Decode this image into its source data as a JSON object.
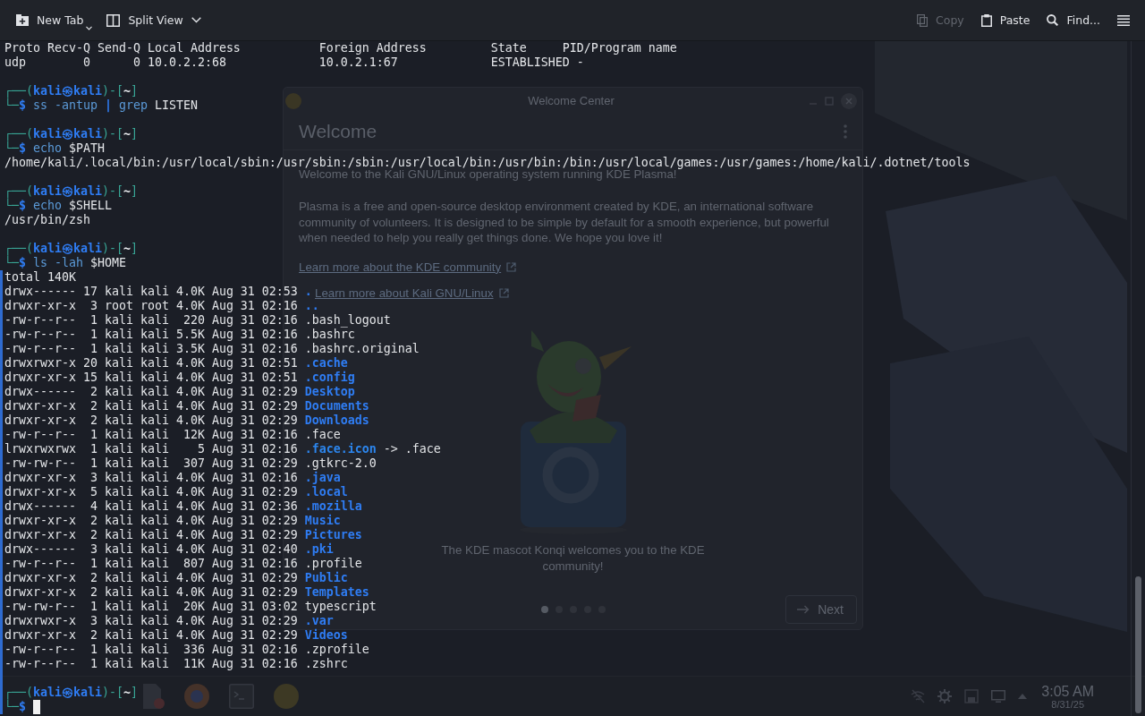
{
  "toolbar": {
    "buttons_left": [
      {
        "kind": "new-tab",
        "label": "New Tab",
        "disabled": false
      },
      {
        "kind": "split-view",
        "label": "Split View",
        "disabled": false
      }
    ],
    "buttons_right": [
      {
        "kind": "copy",
        "label": "Copy",
        "disabled": true
      },
      {
        "kind": "paste",
        "label": "Paste",
        "disabled": false
      },
      {
        "kind": "find",
        "label": "Find...",
        "disabled": false
      }
    ]
  },
  "terminal": {
    "lines": [
      {
        "kind": "output",
        "segments": [
          {
            "text": "Proto Recv-Q Send-Q Local Address           Foreign Address         State     PID/Program name",
            "kind": "text"
          }
        ]
      },
      {
        "kind": "output",
        "segments": [
          {
            "text": "udp        0      0 10.0.2.2:68             10.0.2.1:67             ESTABLISHED -",
            "kind": "text"
          }
        ]
      },
      {
        "kind": "blank"
      },
      {
        "kind": "prompt",
        "segments": [
          {
            "text": "┌──(",
            "kind": "frame"
          },
          {
            "text": "kali㉿kali",
            "kind": "user"
          },
          {
            "text": ")-[",
            "kind": "frame"
          },
          {
            "text": "~",
            "kind": "path"
          },
          {
            "text": "]",
            "kind": "frame"
          }
        ]
      },
      {
        "kind": "command",
        "segments": [
          {
            "text": "└─",
            "kind": "frame"
          },
          {
            "text": "$",
            "kind": "sigil"
          },
          {
            "text": " ss -antup ",
            "kind": "command"
          },
          {
            "text": "|",
            "kind": "pipe"
          },
          {
            "text": " grep",
            "kind": "command"
          },
          {
            "text": " LISTEN",
            "kind": "text"
          }
        ]
      },
      {
        "kind": "blank"
      },
      {
        "kind": "prompt",
        "segments": [
          {
            "text": "┌──(",
            "kind": "frame"
          },
          {
            "text": "kali㉿kali",
            "kind": "user"
          },
          {
            "text": ")-[",
            "kind": "frame"
          },
          {
            "text": "~",
            "kind": "path"
          },
          {
            "text": "]",
            "kind": "frame"
          }
        ]
      },
      {
        "kind": "command",
        "segments": [
          {
            "text": "└─",
            "kind": "frame"
          },
          {
            "text": "$",
            "kind": "sigil"
          },
          {
            "text": " echo",
            "kind": "command"
          },
          {
            "text": " $PATH",
            "kind": "text"
          }
        ]
      },
      {
        "kind": "output",
        "segments": [
          {
            "text": "/home/kali/.local/bin:/usr/local/sbin:/usr/sbin:/sbin:/usr/local/bin:/usr/bin:/bin:/usr/local/games:/usr/games:/home/kali/.dotnet/tools",
            "kind": "text"
          }
        ]
      },
      {
        "kind": "blank"
      },
      {
        "kind": "prompt",
        "segments": [
          {
            "text": "┌──(",
            "kind": "frame"
          },
          {
            "text": "kali㉿kali",
            "kind": "user"
          },
          {
            "text": ")-[",
            "kind": "frame"
          },
          {
            "text": "~",
            "kind": "path"
          },
          {
            "text": "]",
            "kind": "frame"
          }
        ]
      },
      {
        "kind": "command",
        "segments": [
          {
            "text": "└─",
            "kind": "frame"
          },
          {
            "text": "$",
            "kind": "sigil"
          },
          {
            "text": " echo",
            "kind": "command"
          },
          {
            "text": " $SHELL",
            "kind": "text"
          }
        ]
      },
      {
        "kind": "output",
        "segments": [
          {
            "text": "/usr/bin/zsh",
            "kind": "text"
          }
        ]
      },
      {
        "kind": "blank"
      },
      {
        "kind": "prompt",
        "segments": [
          {
            "text": "┌──(",
            "kind": "frame"
          },
          {
            "text": "kali㉿kali",
            "kind": "user"
          },
          {
            "text": ")-[",
            "kind": "frame"
          },
          {
            "text": "~",
            "kind": "path"
          },
          {
            "text": "]",
            "kind": "frame"
          }
        ]
      },
      {
        "kind": "command",
        "segments": [
          {
            "text": "└─",
            "kind": "frame"
          },
          {
            "text": "$",
            "kind": "sigil"
          },
          {
            "text": " ls -lah",
            "kind": "command"
          },
          {
            "text": " $HOME",
            "kind": "text"
          }
        ]
      },
      {
        "kind": "output",
        "segments": [
          {
            "text": "total 140K",
            "kind": "text"
          }
        ]
      },
      {
        "kind": "entry",
        "segments": [
          {
            "text": "drwx------ 17 kali kali 4.0K Aug 31 02:53 ",
            "kind": "text"
          },
          {
            "text": ".",
            "kind": "directory"
          }
        ]
      },
      {
        "kind": "entry",
        "segments": [
          {
            "text": "drwxr-xr-x  3 root root 4.0K Aug 31 02:16 ",
            "kind": "text"
          },
          {
            "text": "..",
            "kind": "directory"
          }
        ]
      },
      {
        "kind": "entry",
        "segments": [
          {
            "text": "-rw-r--r--  1 kali kali  220 Aug 31 02:16 .bash_logout",
            "kind": "text"
          }
        ]
      },
      {
        "kind": "entry",
        "segments": [
          {
            "text": "-rw-r--r--  1 kali kali 5.5K Aug 31 02:16 .bashrc",
            "kind": "text"
          }
        ]
      },
      {
        "kind": "entry",
        "segments": [
          {
            "text": "-rw-r--r--  1 kali kali 3.5K Aug 31 02:16 .bashrc.original",
            "kind": "text"
          }
        ]
      },
      {
        "kind": "entry",
        "segments": [
          {
            "text": "drwxrwxr-x 20 kali kali 4.0K Aug 31 02:51 ",
            "kind": "text"
          },
          {
            "text": ".cache",
            "kind": "directory"
          }
        ]
      },
      {
        "kind": "entry",
        "segments": [
          {
            "text": "drwxr-xr-x 15 kali kali 4.0K Aug 31 02:51 ",
            "kind": "text"
          },
          {
            "text": ".config",
            "kind": "directory"
          }
        ]
      },
      {
        "kind": "entry",
        "segments": [
          {
            "text": "drwx------  2 kali kali 4.0K Aug 31 02:29 ",
            "kind": "text"
          },
          {
            "text": "Desktop",
            "kind": "directory"
          }
        ]
      },
      {
        "kind": "entry",
        "segments": [
          {
            "text": "drwxr-xr-x  2 kali kali 4.0K Aug 31 02:29 ",
            "kind": "text"
          },
          {
            "text": "Documents",
            "kind": "directory"
          }
        ]
      },
      {
        "kind": "entry",
        "segments": [
          {
            "text": "drwxr-xr-x  2 kali kali 4.0K Aug 31 02:29 ",
            "kind": "text"
          },
          {
            "text": "Downloads",
            "kind": "directory"
          }
        ]
      },
      {
        "kind": "entry",
        "segments": [
          {
            "text": "-rw-r--r--  1 kali kali  12K Aug 31 02:16 .face",
            "kind": "text"
          }
        ]
      },
      {
        "kind": "entry",
        "segments": [
          {
            "text": "lrwxrwxrwx  1 kali kali    5 Aug 31 02:16 ",
            "kind": "text"
          },
          {
            "text": ".face.icon",
            "kind": "symlink"
          },
          {
            "text": " -> .face",
            "kind": "text"
          }
        ]
      },
      {
        "kind": "entry",
        "segments": [
          {
            "text": "-rw-rw-r--  1 kali kali  307 Aug 31 02:29 .gtkrc-2.0",
            "kind": "text"
          }
        ]
      },
      {
        "kind": "entry",
        "segments": [
          {
            "text": "drwxr-xr-x  3 kali kali 4.0K Aug 31 02:16 ",
            "kind": "text"
          },
          {
            "text": ".java",
            "kind": "directory"
          }
        ]
      },
      {
        "kind": "entry",
        "segments": [
          {
            "text": "drwxr-xr-x  5 kali kali 4.0K Aug 31 02:29 ",
            "kind": "text"
          },
          {
            "text": ".local",
            "kind": "directory"
          }
        ]
      },
      {
        "kind": "entry",
        "segments": [
          {
            "text": "drwx------  4 kali kali 4.0K Aug 31 02:36 ",
            "kind": "text"
          },
          {
            "text": ".mozilla",
            "kind": "directory"
          }
        ]
      },
      {
        "kind": "entry",
        "segments": [
          {
            "text": "drwxr-xr-x  2 kali kali 4.0K Aug 31 02:29 ",
            "kind": "text"
          },
          {
            "text": "Music",
            "kind": "directory"
          }
        ]
      },
      {
        "kind": "entry",
        "segments": [
          {
            "text": "drwxr-xr-x  2 kali kali 4.0K Aug 31 02:29 ",
            "kind": "text"
          },
          {
            "text": "Pictures",
            "kind": "directory"
          }
        ]
      },
      {
        "kind": "entry",
        "segments": [
          {
            "text": "drwx------  3 kali kali 4.0K Aug 31 02:40 ",
            "kind": "text"
          },
          {
            "text": ".pki",
            "kind": "directory"
          }
        ]
      },
      {
        "kind": "entry",
        "segments": [
          {
            "text": "-rw-r--r--  1 kali kali  807 Aug 31 02:16 .profile",
            "kind": "text"
          }
        ]
      },
      {
        "kind": "entry",
        "segments": [
          {
            "text": "drwxr-xr-x  2 kali kali 4.0K Aug 31 02:29 ",
            "kind": "text"
          },
          {
            "text": "Public",
            "kind": "directory"
          }
        ]
      },
      {
        "kind": "entry",
        "segments": [
          {
            "text": "drwxr-xr-x  2 kali kali 4.0K Aug 31 02:29 ",
            "kind": "text"
          },
          {
            "text": "Templates",
            "kind": "directory"
          }
        ]
      },
      {
        "kind": "entry",
        "segments": [
          {
            "text": "-rw-rw-r--  1 kali kali  20K Aug 31 03:02 typescript",
            "kind": "text"
          }
        ]
      },
      {
        "kind": "entry",
        "segments": [
          {
            "text": "drwxrwxr-x  3 kali kali 4.0K Aug 31 02:29 ",
            "kind": "text"
          },
          {
            "text": ".var",
            "kind": "directory"
          }
        ]
      },
      {
        "kind": "entry",
        "segments": [
          {
            "text": "drwxr-xr-x  2 kali kali 4.0K Aug 31 02:29 ",
            "kind": "text"
          },
          {
            "text": "Videos",
            "kind": "directory"
          }
        ]
      },
      {
        "kind": "entry",
        "segments": [
          {
            "text": "-rw-r--r--  1 kali kali  336 Aug 31 02:16 .zprofile",
            "kind": "text"
          }
        ]
      },
      {
        "kind": "entry",
        "segments": [
          {
            "text": "-rw-r--r--  1 kali kali  11K Aug 31 02:16 .zshrc",
            "kind": "text"
          }
        ]
      },
      {
        "kind": "blank"
      },
      {
        "kind": "prompt",
        "segments": [
          {
            "text": "┌──(",
            "kind": "frame"
          },
          {
            "text": "kali㉿kali",
            "kind": "user"
          },
          {
            "text": ")-[",
            "kind": "frame"
          },
          {
            "text": "~",
            "kind": "path"
          },
          {
            "text": "]",
            "kind": "frame"
          }
        ]
      },
      {
        "kind": "input",
        "segments": [
          {
            "text": "└─",
            "kind": "frame"
          },
          {
            "text": "$",
            "kind": "sigil"
          }
        ],
        "cursor": true
      }
    ]
  },
  "desktop": {
    "welcome_window": {
      "title": "Welcome Center",
      "heading": "Welcome",
      "intro": "Welcome to the Kali GNU/Linux operating system running KDE Plasma!",
      "body": "Plasma is a free and open-source desktop environment created by KDE, an international software community of volunteers. It is designed to be simple by default for a smooth experience, but powerful when needed to help you really get things done. We hope you love it!",
      "links": [
        "Learn more about the KDE community",
        "Learn more about Kali GNU/Linux"
      ],
      "caption": "The KDE mascot Konqi welcomes you to the KDE community!",
      "pages": [
        {
          "selected": true
        },
        {
          "selected": false
        },
        {
          "selected": false
        },
        {
          "selected": false
        },
        {
          "selected": false
        }
      ],
      "next_button": "Next"
    },
    "taskbar": {
      "time": "3:05 AM",
      "date": "8/31/25"
    }
  }
}
